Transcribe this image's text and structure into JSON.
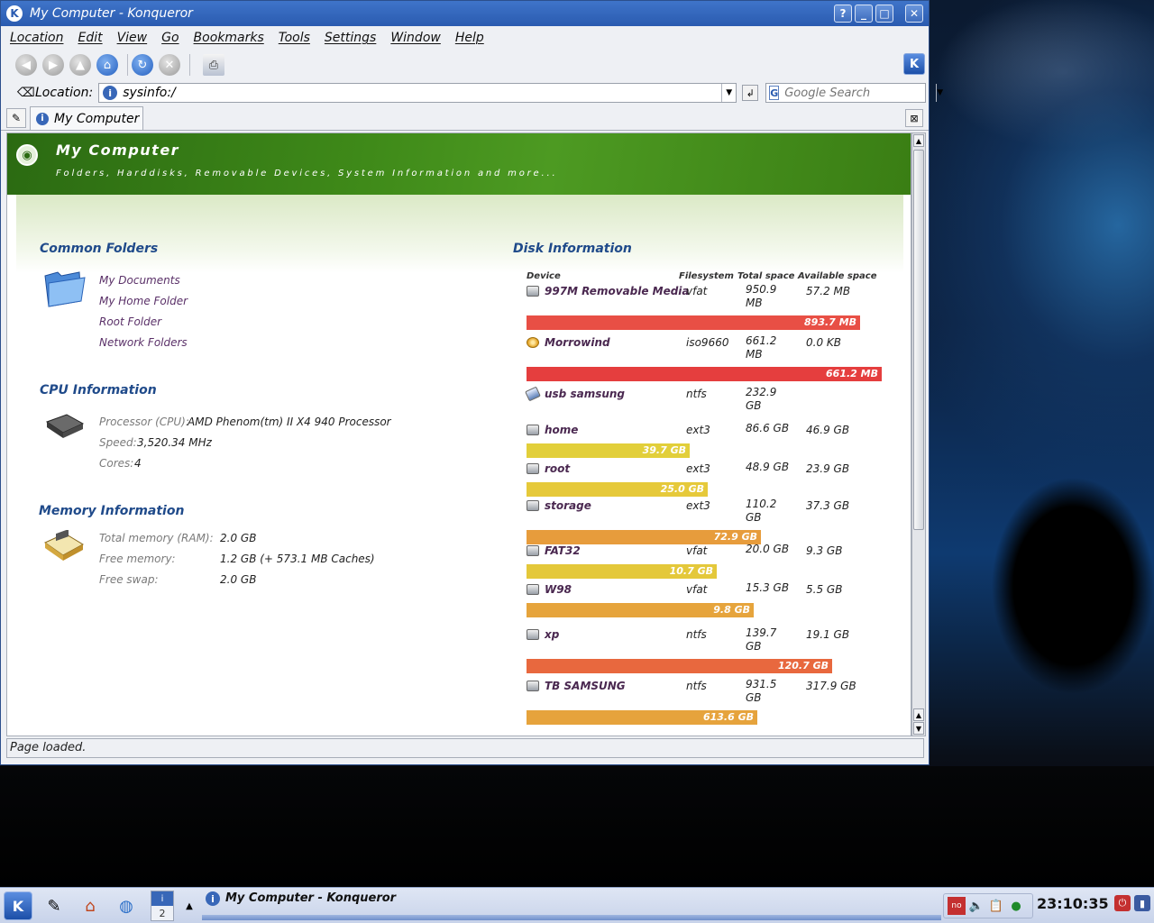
{
  "window": {
    "title": "My Computer - Konqueror",
    "help_btn": "?",
    "min_btn": "_",
    "max_btn": "□",
    "close_btn": "✕"
  },
  "menubar": [
    "Location",
    "Edit",
    "View",
    "Go",
    "Bookmarks",
    "Tools",
    "Settings",
    "Window",
    "Help"
  ],
  "toolbar": {
    "buttons": [
      "back-icon",
      "forward-icon",
      "up-icon",
      "home-icon",
      "reload-icon",
      "stop-icon",
      "print-icon"
    ]
  },
  "location": {
    "label": "Location:",
    "url": "sysinfo:/",
    "search_placeholder": "Google Search"
  },
  "tab": {
    "label": "My Computer"
  },
  "banner": {
    "title": "My Computer",
    "subtitle": "Folders, Harddisks, Removable Devices, System Information and more..."
  },
  "common_folders": {
    "title": "Common Folders",
    "links": [
      "My Documents",
      "My Home Folder",
      "Root Folder",
      "Network Folders"
    ]
  },
  "cpu": {
    "title": "CPU Information",
    "processor_label": "Processor (CPU):",
    "processor_value": "AMD Phenom(tm) II X4 940 Processor",
    "speed_label": "Speed:",
    "speed_value": "3,520.34 MHz",
    "cores_label": "Cores:",
    "cores_value": "4"
  },
  "memory": {
    "title": "Memory Information",
    "total_label": "Total memory (RAM):",
    "total_value": "2.0 GB",
    "free_label": "Free memory:",
    "free_value": "1.2 GB (+ 573.1 MB Caches)",
    "swap_label": "Free swap:",
    "swap_value": "2.0 GB"
  },
  "disks": {
    "title": "Disk Information",
    "headers": [
      "Device",
      "Filesystem",
      "Total space",
      "Available space"
    ],
    "rows": [
      {
        "name": "997M Removable Media",
        "fs": "vfat",
        "total": "950.9 MB",
        "avail": "57.2 MB",
        "used": "893.7 MB",
        "fraction": 0.94,
        "color": "#e84f45",
        "icon": "removable-media-icon"
      },
      {
        "name": "Morrowind",
        "fs": "iso9660",
        "total": "661.2 MB",
        "avail": "0.0 KB",
        "used": "661.2 MB",
        "fraction": 1.0,
        "color": "#e53e3e",
        "icon": "cdrom-icon"
      },
      {
        "name": "usb samsung",
        "fs": "ntfs",
        "total": "232.9 GB",
        "avail": "",
        "used": "",
        "fraction": 0,
        "color": "#e53e3e",
        "icon": "usb-drive-icon"
      },
      {
        "name": "home",
        "fs": "ext3",
        "total": "86.6 GB",
        "avail": "46.9 GB",
        "used": "39.7 GB",
        "fraction": 0.46,
        "color": "#e2cf3a",
        "icon": "harddisk-icon"
      },
      {
        "name": "root",
        "fs": "ext3",
        "total": "48.9 GB",
        "avail": "23.9 GB",
        "used": "25.0 GB",
        "fraction": 0.51,
        "color": "#e6c93a",
        "icon": "harddisk-icon"
      },
      {
        "name": "storage",
        "fs": "ext3",
        "total": "110.2 GB",
        "avail": "37.3 GB",
        "used": "72.9 GB",
        "fraction": 0.66,
        "color": "#e79c3c",
        "icon": "harddisk-icon"
      },
      {
        "name": "FAT32",
        "fs": "vfat",
        "total": "20.0 GB",
        "avail": "9.3 GB",
        "used": "10.7 GB",
        "fraction": 0.535,
        "color": "#e4c83a",
        "icon": "harddisk-icon"
      },
      {
        "name": "W98",
        "fs": "vfat",
        "total": "15.3 GB",
        "avail": "5.5 GB",
        "used": "9.8 GB",
        "fraction": 0.64,
        "color": "#e6a43c",
        "icon": "harddisk-icon"
      },
      {
        "name": "xp",
        "fs": "ntfs",
        "total": "139.7 GB",
        "avail": "19.1 GB",
        "used": "120.7 GB",
        "fraction": 0.86,
        "color": "#e8683e",
        "icon": "harddisk-icon"
      },
      {
        "name": "TB SAMSUNG",
        "fs": "ntfs",
        "total": "931.5 GB",
        "avail": "317.9 GB",
        "used": "613.6 GB",
        "fraction": 0.65,
        "color": "#e6a33c",
        "icon": "harddisk-icon"
      }
    ]
  },
  "status": "Page loaded.",
  "taskbar": {
    "task_label": "My Computer - Konqueror",
    "pager_current": "2",
    "clock": "23:10:35"
  }
}
